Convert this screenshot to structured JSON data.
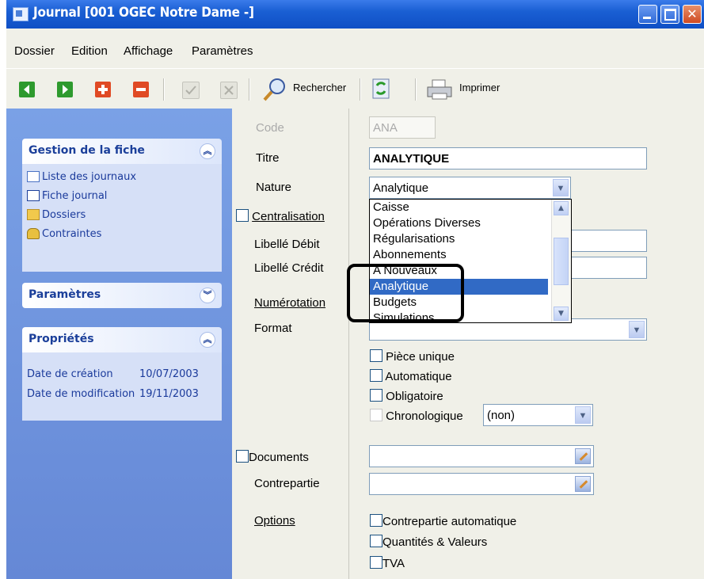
{
  "window": {
    "title": "Journal [001 OGEC      Notre Dame -]"
  },
  "menu": {
    "items": [
      "Dossier",
      "Edition",
      "Affichage",
      "Paramètres"
    ]
  },
  "toolbar": {
    "search_label": "Rechercher",
    "print_label": "Imprimer"
  },
  "sidebar": {
    "gestion": {
      "title": "Gestion de la fiche",
      "links": [
        "Liste des journaux",
        "Fiche journal",
        "Dossiers",
        "Contraintes"
      ]
    },
    "parametres": {
      "title": "Paramètres"
    },
    "proprietes": {
      "title": "Propriétés",
      "creation_label": "Date de création",
      "creation_value": "10/07/2003",
      "modification_label": "Date de modification",
      "modification_value": "19/11/2003"
    }
  },
  "form": {
    "code_label": "Code",
    "code_value": "ANA",
    "titre_label": "Titre",
    "titre_value": "ANALYTIQUE",
    "nature_label": "Nature",
    "nature_value": "Analytique",
    "centralisation_label": "Centralisation",
    "libelle_debit_label": "Libellé Débit",
    "libelle_credit_label": "Libellé Crédit",
    "numerotation_label": "Numérotation",
    "format_label": "Format",
    "piece_unique_label": "Pièce unique",
    "automatique_label": "Automatique",
    "obligatoire_label": "Obligatoire",
    "chronologique_label": "Chronologique",
    "chronologique_value": "(non)",
    "documents_label": "Documents",
    "contrepartie_label": "Contrepartie",
    "options_label": "Options",
    "contrepartie_auto_label": "Contrepartie automatique",
    "quantites_label": "Quantités & Valeurs",
    "tva_label": "TVA"
  },
  "nature_dropdown": {
    "options": [
      "Caisse",
      "Opérations Diverses",
      "Régularisations",
      "Abonnements",
      "A Nouveaux",
      "Analytique",
      "Budgets",
      "Simulations"
    ],
    "selected": "Analytique"
  }
}
